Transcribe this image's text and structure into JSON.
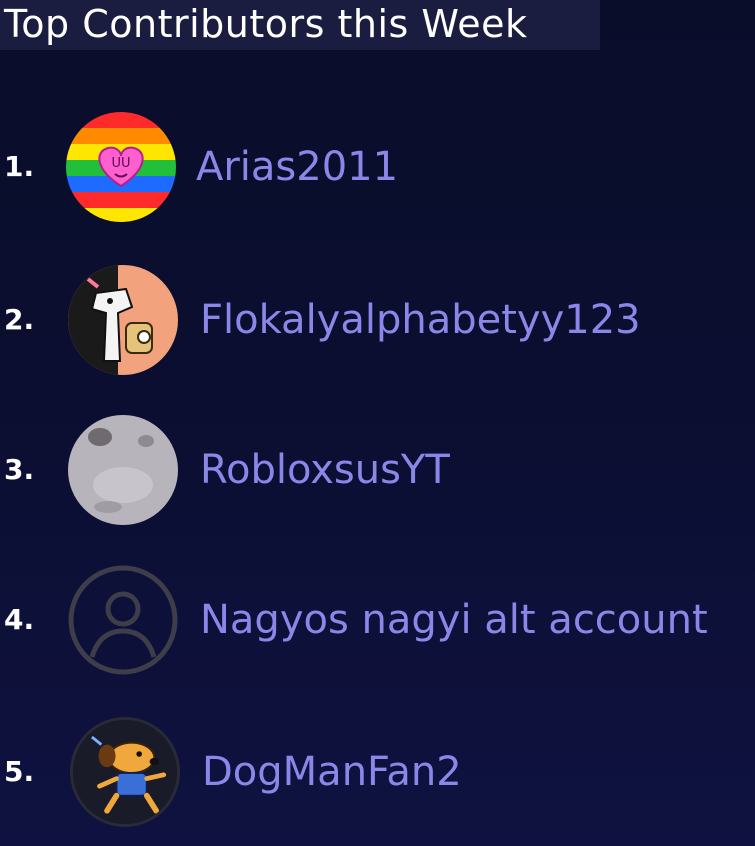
{
  "title": "Top Contributors this Week",
  "colors": {
    "background": "#0b0e30",
    "title_bg": "#1a1d3f",
    "name": "#8a87e8",
    "rank": "#ffffff"
  },
  "contributors": [
    {
      "rank": "1.",
      "name": "Arias2011",
      "avatar": "rainbow-heart-avatar"
    },
    {
      "rank": "2.",
      "name": "Flokalyalphabetyy123",
      "avatar": "cartoon-character-avatar"
    },
    {
      "rank": "3.",
      "name": "RobloxsusYT",
      "avatar": "gray-photo-avatar"
    },
    {
      "rank": "4.",
      "name": "Nagyos nagyi alt account",
      "avatar": "default-user-icon"
    },
    {
      "rank": "5.",
      "name": "DogManFan2",
      "avatar": "dog-man-avatar"
    }
  ]
}
